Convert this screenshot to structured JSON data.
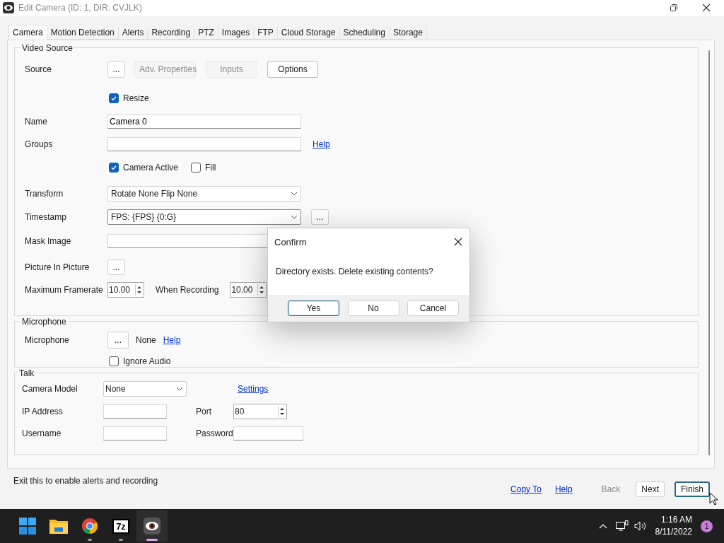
{
  "window": {
    "title": "Edit Camera (ID: 1, DIR: CVJLK)"
  },
  "tabs": [
    {
      "label": "Camera",
      "selected": true
    },
    {
      "label": "Motion Detection",
      "selected": false
    },
    {
      "label": "Alerts",
      "selected": false
    },
    {
      "label": "Recording",
      "selected": false
    },
    {
      "label": "PTZ",
      "selected": false
    },
    {
      "label": "Images",
      "selected": false
    },
    {
      "label": "FTP",
      "selected": false
    },
    {
      "label": "Cloud Storage",
      "selected": false
    },
    {
      "label": "Scheduling",
      "selected": false
    },
    {
      "label": "Storage",
      "selected": false
    }
  ],
  "video_source": {
    "title": "Video Source",
    "source": {
      "label": "Source",
      "buttons": [
        {
          "label": "...",
          "disabled": false
        },
        {
          "label": "Adv. Properties",
          "disabled": true
        },
        {
          "label": "Inputs",
          "disabled": true
        },
        {
          "label": "Options",
          "disabled": false
        }
      ]
    },
    "resize": {
      "label": "Resize",
      "checked": true
    },
    "name": {
      "label": "Name",
      "value": "Camera 0"
    },
    "groups": {
      "label": "Groups",
      "link": "Help"
    },
    "camera_active": {
      "label": "Camera Active",
      "checked": true
    },
    "fill": {
      "label": "Fill",
      "checked": false
    },
    "transform": {
      "label": "Transform",
      "value": "Rotate None Flip None"
    },
    "timestamp": {
      "label": "Timestamp",
      "value": "FPS: {FPS} {0:G}",
      "button": "..."
    },
    "mask_image": {
      "label": "Mask Image"
    },
    "picture_in_picture": {
      "label": "Picture In Picture",
      "button": "..."
    },
    "maximum_framerate": {
      "label": "Maximum Framerate",
      "value": "10.00"
    },
    "when_recording": {
      "label": "When Recording",
      "value": "10.00"
    }
  },
  "microphone": {
    "title": "Microphone",
    "label": "Microphone",
    "button": "...",
    "value": "None",
    "link": "Help",
    "ignore_audio": {
      "label": "Ignore Audio",
      "checked": false
    }
  },
  "talk": {
    "title": "Talk",
    "camera_model": {
      "label": "Camera Model",
      "value": "None"
    },
    "settings_link": "Settings",
    "ip_address": {
      "label": "IP Address"
    },
    "port": {
      "label": "Port",
      "value": "80"
    },
    "username": {
      "label": "Username"
    },
    "password": {
      "label": "Password"
    }
  },
  "footer": {
    "status": "Exit this to enable alerts and recording",
    "links": [
      "Copy To",
      "Help"
    ],
    "buttons": [
      {
        "label": "Back",
        "disabled": true,
        "focused": false
      },
      {
        "label": "Next",
        "disabled": false,
        "focused": false
      },
      {
        "label": "Finish",
        "disabled": false,
        "focused": true
      }
    ]
  },
  "dialog": {
    "title": "Confirm",
    "message": "Directory exists. Delete existing contents?",
    "buttons": [
      {
        "label": "Yes",
        "focused": true
      },
      {
        "label": "No",
        "focused": false
      },
      {
        "label": "Cancel",
        "focused": false
      }
    ]
  },
  "taskbar": {
    "apps": [
      {
        "kind": "start",
        "running": false,
        "active": false
      },
      {
        "kind": "files",
        "running": false,
        "active": false
      },
      {
        "kind": "chrome",
        "running": true,
        "active": false
      },
      {
        "kind": "archiver",
        "label": "7z",
        "running": true,
        "active": false
      },
      {
        "kind": "camera",
        "running": true,
        "active": true
      }
    ],
    "time": "1:16 AM",
    "date": "8/11/2022",
    "notifications": "1"
  }
}
